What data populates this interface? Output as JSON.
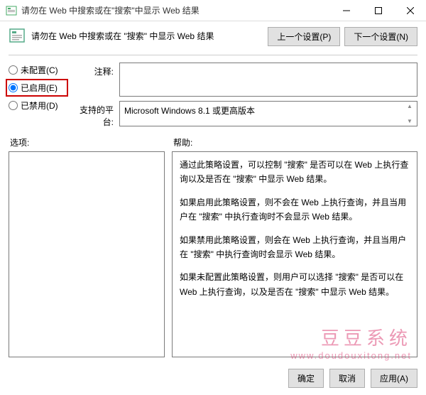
{
  "window": {
    "title": "请勿在 Web 中搜索或在\"搜索\"中显示 Web 结果",
    "minimize": "—",
    "maximize": "□",
    "close": "×"
  },
  "header": {
    "title": "请勿在 Web 中搜索或在 \"搜索\" 中显示 Web 结果",
    "prev": "上一个设置(P)",
    "next": "下一个设置(N)"
  },
  "radios": {
    "not_configured": "未配置(C)",
    "enabled": "已启用(E)",
    "disabled": "已禁用(D)"
  },
  "fields": {
    "comment_label": "注释:",
    "comment_value": "",
    "platform_label": "支持的平台:",
    "platform_value": "Microsoft Windows 8.1 或更高版本"
  },
  "lower": {
    "options_label": "选项:",
    "help_label": "帮助:"
  },
  "help": {
    "p1": "通过此策略设置，可以控制 \"搜索\" 是否可以在 Web 上执行查询以及是否在 \"搜索\" 中显示 Web 结果。",
    "p2": "如果启用此策略设置，则不会在 Web 上执行查询，并且当用户在 \"搜索\" 中执行查询时不会显示 Web 结果。",
    "p3": "如果禁用此策略设置，则会在 Web 上执行查询，并且当用户在 \"搜索\" 中执行查询时会显示 Web 结果。",
    "p4": "如果未配置此策略设置，则用户可以选择 \"搜索\" 是否可以在 Web 上执行查询，以及是否在 \"搜索\" 中显示 Web 结果。"
  },
  "footer": {
    "ok": "确定",
    "cancel": "取消",
    "apply": "应用(A)"
  },
  "watermark": {
    "line1": "豆豆系统",
    "line2": "www.doudouxitong.net"
  }
}
